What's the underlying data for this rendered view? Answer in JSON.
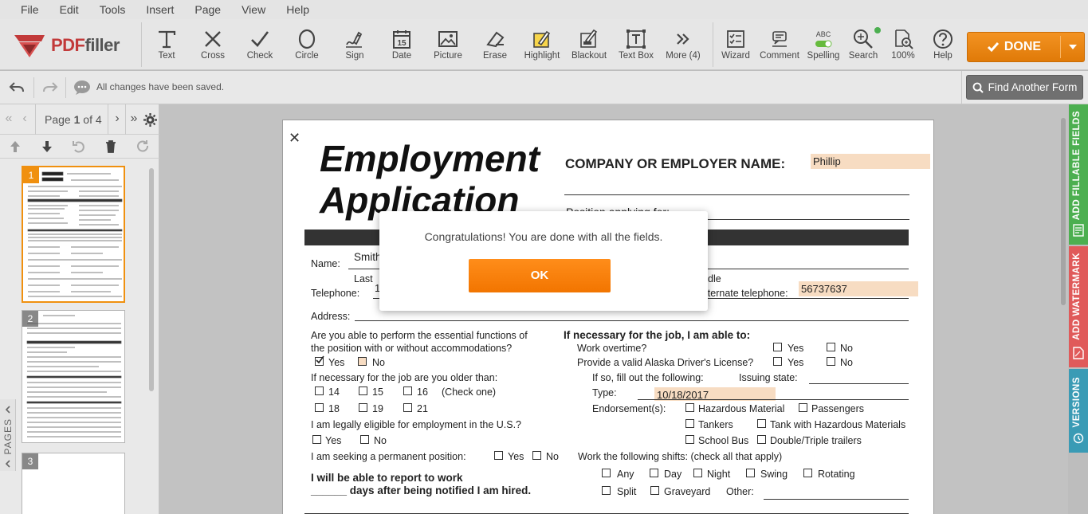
{
  "menu": [
    "File",
    "Edit",
    "Tools",
    "Insert",
    "Page",
    "View",
    "Help"
  ],
  "logo": {
    "brand_a": "PDF",
    "brand_b": "filler"
  },
  "tools": [
    {
      "label": "Text",
      "icon": "text-icon"
    },
    {
      "label": "Cross",
      "icon": "cross-icon"
    },
    {
      "label": "Check",
      "icon": "check-icon"
    },
    {
      "label": "Circle",
      "icon": "circle-icon"
    },
    {
      "label": "Sign",
      "icon": "sign-icon"
    },
    {
      "label": "Date",
      "icon": "date-icon",
      "glyph": "15"
    },
    {
      "label": "Picture",
      "icon": "picture-icon"
    },
    {
      "label": "Erase",
      "icon": "erase-icon"
    },
    {
      "label": "Highlight",
      "icon": "highlight-icon"
    },
    {
      "label": "Blackout",
      "icon": "blackout-icon"
    },
    {
      "label": "Text Box",
      "icon": "textbox-icon"
    },
    {
      "label": "More (4)",
      "icon": "more-icon"
    },
    {
      "label": "Wizard",
      "icon": "wizard-icon"
    },
    {
      "label": "Comment",
      "icon": "comment-icon"
    },
    {
      "label": "Spelling",
      "icon": "spelling-icon",
      "glyph": "ABC"
    },
    {
      "label": "Search",
      "icon": "search-icon"
    },
    {
      "label": "100%",
      "icon": "zoom-icon"
    },
    {
      "label": "Help",
      "icon": "help-icon"
    }
  ],
  "done": {
    "label": "DONE"
  },
  "status": {
    "saved": "All changes have been saved."
  },
  "find_form": {
    "label": "Find Another Form"
  },
  "pagenav": {
    "page_word": "Page",
    "current": "1",
    "of_word": "of",
    "total": "4"
  },
  "pages_label": "PAGES",
  "thumbnails": [
    {
      "num": "1"
    },
    {
      "num": "2"
    },
    {
      "num": "3"
    }
  ],
  "side_tabs": [
    {
      "label": "ADD FILLABLE FIELDS",
      "color": "#4caf50"
    },
    {
      "label": "ADD WATERMARK",
      "color": "#e05a5a"
    },
    {
      "label": "VERSIONS",
      "color": "#3a9bb5"
    }
  ],
  "modal": {
    "message": "Congratulations! You are done with all the fields.",
    "ok": "OK"
  },
  "doc": {
    "title_1": "Employment",
    "title_2": "Application",
    "company_label": "COMPANY OR EMPLOYER NAME:",
    "company_value": "Phillip",
    "position_label": "Position applying for:",
    "name_label": "Name:",
    "name_value": "Smith",
    "last_label": "Last",
    "middle_label": "dle",
    "telephone_label": "Telephone:",
    "telephone_value": "1",
    "alt_tel_label": "lternate telephone:",
    "alt_tel_value": "56737637",
    "address_label": "Address:",
    "q_essential_1": "Are you able to perform the essential functions of",
    "q_essential_2": "the position with or without accommodations?",
    "yes": "Yes",
    "no": "No",
    "q_older": "If necessary for the job are you older than:",
    "age_14": "14",
    "age_15": "15",
    "age_16": "16",
    "check_one": "(Check one)",
    "age_18": "18",
    "age_19": "19",
    "age_21": "21",
    "q_eligible": "I am legally eligible for employment in the U.S.?",
    "q_permanent": "I am seeking a permanent position:",
    "report_1": "I will be able to report to work",
    "report_2": "______ days after being notified I am hired.",
    "able_header": "If necessary for the job, I am able to:",
    "overtime": "Work overtime?",
    "alaska": "Provide a valid Alaska Driver's License?",
    "fill_following": "If so, fill out the following:",
    "issuing_state": "Issuing state:",
    "type_label": "Type:",
    "type_value": "10/18/2017",
    "endorsements": "Endorsement(s):",
    "hazmat": "Hazardous Material",
    "passengers": "Passengers",
    "tankers": "Tankers",
    "tank_hazmat": "Tank with Hazardous Materials",
    "school_bus": "School Bus",
    "double_triple": "Double/Triple trailers",
    "shifts": "Work the following shifts: (check all that apply)",
    "any": "Any",
    "day": "Day",
    "night": "Night",
    "swing": "Swing",
    "rotating": "Rotating",
    "split": "Split",
    "graveyard": "Graveyard",
    "other": "Other:"
  }
}
